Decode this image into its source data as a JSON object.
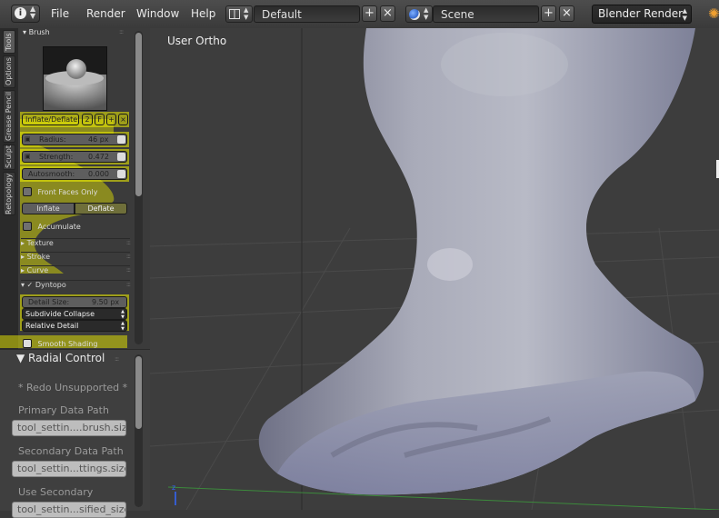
{
  "menu": {
    "file": "File",
    "render": "Render",
    "window": "Window",
    "help": "Help"
  },
  "layout": {
    "name": "Default"
  },
  "scene": {
    "name": "Scene"
  },
  "engine": {
    "name": "Blender Render"
  },
  "tabs": [
    "Tools",
    "Options",
    "Grease Pencil",
    "Sculpt",
    "Retopology"
  ],
  "brush": {
    "panel_title": "Brush",
    "name": "Inflate/Deflate",
    "users": "2",
    "fake_user": "F",
    "radius_label": "Radius:",
    "radius_value": "46 px",
    "radius_fill": 0.46,
    "strength_label": "Strength:",
    "strength_value": "0.472",
    "strength_fill": 0.472,
    "autosmooth_label": "Autosmooth:",
    "autosmooth_value": "0.000",
    "autosmooth_fill": 0.0,
    "front_faces": "Front Faces Only",
    "inflate": "Inflate",
    "deflate": "Deflate",
    "accumulate": "Accumulate"
  },
  "subpanels": {
    "texture": "Texture",
    "stroke": "Stroke",
    "curve": "Curve",
    "dyntopo": "Dyntopo"
  },
  "dyntopo": {
    "detail_label": "Detail Size:",
    "detail_value": "9.50 px",
    "subdivide": "Subdivide Collapse",
    "relative": "Relative Detail",
    "smooth": "Smooth Shading"
  },
  "radial": {
    "title": "Radial Control",
    "redo": "* Redo Unsupported *",
    "primary_label": "Primary Data Path",
    "primary_value": "tool_settin....brush.size",
    "secondary_label": "Secondary Data Path",
    "secondary_value": "tool_settin...ttings.size",
    "use_secondary_label": "Use Secondary",
    "use_secondary_value": "tool_settin...sified_size"
  },
  "viewport": {
    "label": "User Ortho"
  },
  "colors": {
    "highlight": "#f0f000",
    "header": "#444444",
    "panel": "#3b3b3b",
    "viewport": "#3d3d3d",
    "mesh": "#a8aab8"
  }
}
